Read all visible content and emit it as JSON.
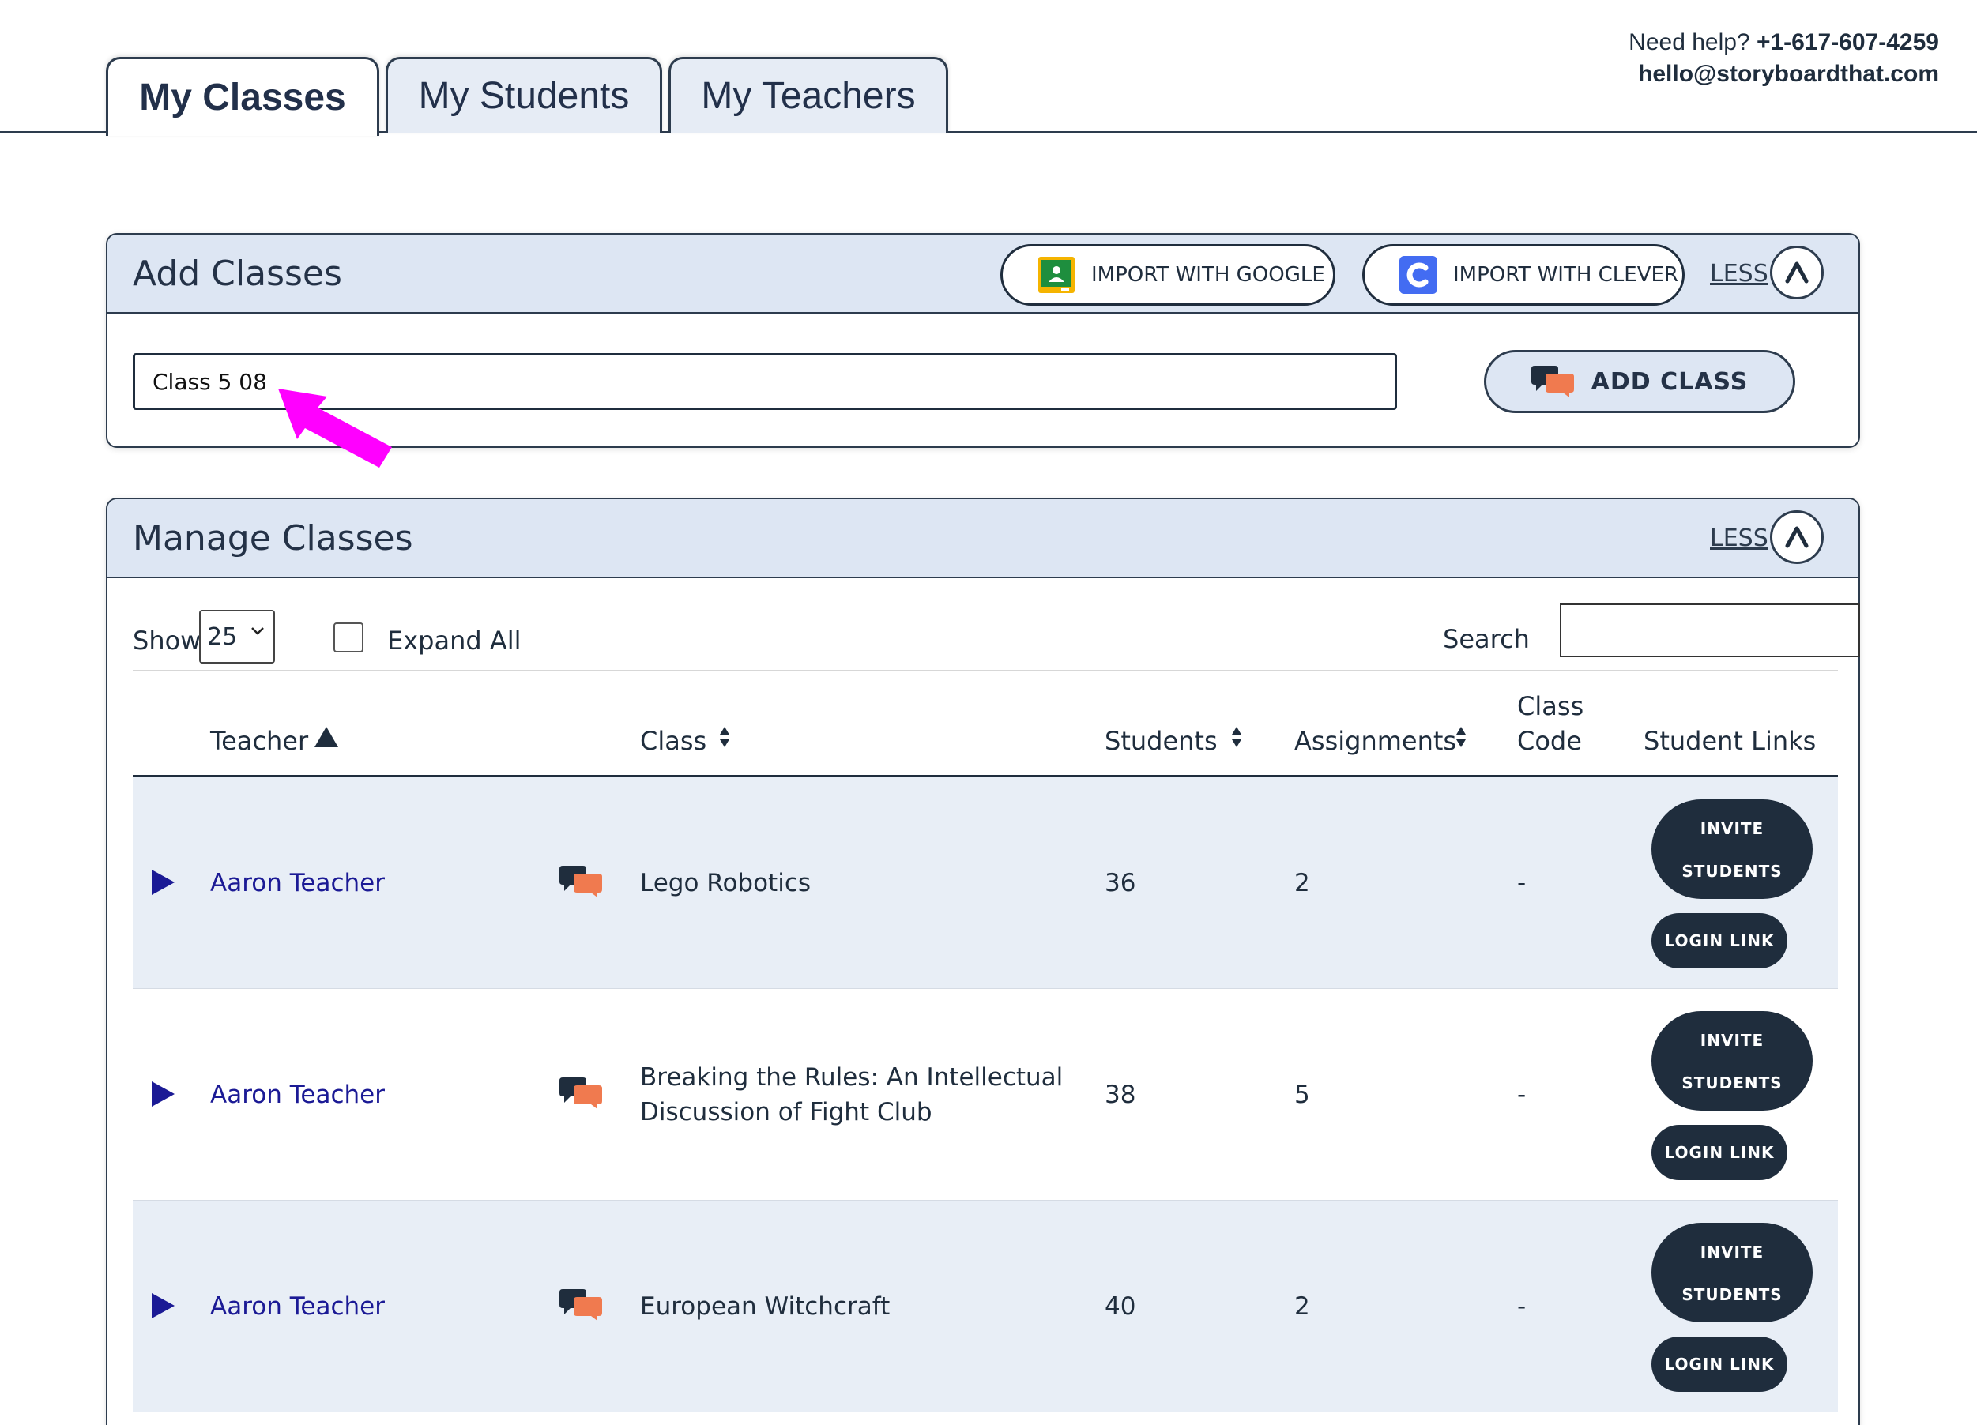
{
  "tabs": [
    {
      "label": "My Classes",
      "active": true
    },
    {
      "label": "My Students",
      "active": false
    },
    {
      "label": "My Teachers",
      "active": false
    }
  ],
  "help": {
    "prefix": "Need help? ",
    "phone": "+1-617-607-4259",
    "email": "hello@storyboardthat.com"
  },
  "add_classes": {
    "title": "Add Classes",
    "import_google_label": "IMPORT WITH GOOGLE",
    "import_clever_label": "IMPORT WITH CLEVER",
    "less_label": "LESS",
    "class_name_value": "Class 5 08",
    "add_class_label": "ADD CLASS"
  },
  "manage_classes": {
    "title": "Manage Classes",
    "less_label": "LESS",
    "show_label": "Show",
    "show_value": "25",
    "expand_all_label": "Expand All",
    "search_label": "Search",
    "search_value": "",
    "columns": {
      "teacher": "Teacher",
      "class": "Class",
      "students": "Students",
      "assignments": "Assignments",
      "class_code_line1": "Class",
      "class_code_line2": "Code",
      "student_links": "Student Links"
    },
    "rows": [
      {
        "teacher": "Aaron Teacher",
        "class_line1": "Lego Robotics",
        "class_line2": "",
        "students": "36",
        "assignments": "2",
        "code": "-",
        "invite_line1": "INVITE",
        "invite_line2": "STUDENTS",
        "login": "LOGIN LINK"
      },
      {
        "teacher": "Aaron Teacher",
        "class_line1": "Breaking the Rules: An Intellectual",
        "class_line2": "Discussion of Fight Club",
        "students": "38",
        "assignments": "5",
        "code": "-",
        "invite_line1": "INVITE",
        "invite_line2": "STUDENTS",
        "login": "LOGIN LINK"
      },
      {
        "teacher": "Aaron Teacher",
        "class_line1": "European Witchcraft",
        "class_line2": "",
        "students": "40",
        "assignments": "2",
        "code": "-",
        "invite_line1": "INVITE",
        "invite_line2": "STUDENTS",
        "login": "LOGIN LINK"
      }
    ]
  },
  "icons": {
    "google": "google-classroom-icon",
    "clever": "clever-icon",
    "chat": "chat-bubbles-icon",
    "collapse": "chevron-up-icon",
    "expand_row": "triangle-right-icon",
    "sort": "sort-arrows-icon",
    "arrow": "pointer-arrow-icon"
  },
  "colors": {
    "navy": "#1f2d3d",
    "header_bg": "#dde6f3",
    "row_shaded": "#e8eef6",
    "link": "#1b1a95",
    "accent_orange": "#f07a4f",
    "annotation_magenta": "#ff00ff"
  }
}
